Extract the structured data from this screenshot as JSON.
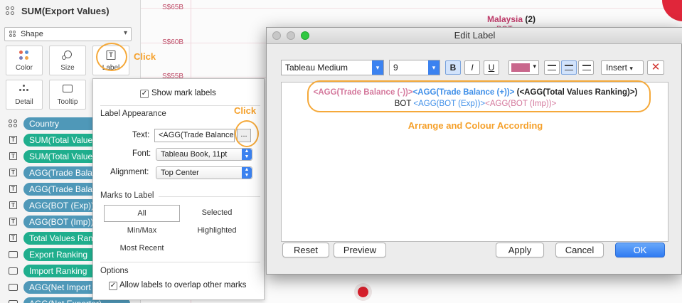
{
  "marks_card": {
    "title": "SUM(Export Values)",
    "mark_type": "Shape",
    "buttons": [
      {
        "label": "Color",
        "icon": "color-dots-icon"
      },
      {
        "label": "Size",
        "icon": "size-icon"
      },
      {
        "label": "Label",
        "icon": "label-icon"
      },
      {
        "label": "Detail",
        "icon": "detail-icon"
      },
      {
        "label": "Tooltip",
        "icon": "tooltip-icon"
      }
    ],
    "fields": [
      {
        "label": "Country",
        "type": "dimension",
        "icon": "detail-dots-icon"
      },
      {
        "label": "SUM(Total Values",
        "type": "measure",
        "icon": "label-icon"
      },
      {
        "label": "SUM(Total Value",
        "type": "measure",
        "icon": "label-icon"
      },
      {
        "label": "AGG(Trade Bala",
        "type": "agg",
        "icon": "label-icon"
      },
      {
        "label": "AGG(Trade Bala",
        "type": "agg",
        "icon": "label-icon"
      },
      {
        "label": "AGG(BOT (Exp))",
        "type": "agg",
        "icon": "label-icon"
      },
      {
        "label": "AGG(BOT (Imp))",
        "type": "agg",
        "icon": "label-icon"
      },
      {
        "label": "Total Values Ran",
        "type": "measure",
        "icon": "label-icon"
      },
      {
        "label": "Export Ranking",
        "type": "measure",
        "icon": "tooltip-icon"
      },
      {
        "label": "Import Ranking",
        "type": "measure",
        "icon": "tooltip-icon"
      },
      {
        "label": "AGG(Net Import",
        "type": "agg",
        "icon": "tooltip-icon"
      },
      {
        "label": "AGG(Net Exporter)",
        "type": "agg",
        "icon": "tooltip-icon"
      }
    ]
  },
  "callouts": {
    "click_1": "Click",
    "click_2": "Click",
    "arrange": "Arrange and Colour According"
  },
  "label_popover": {
    "show_mark_labels": "Show mark labels",
    "show_mark_labels_checked": true,
    "appearance_heading": "Label Appearance",
    "text_label": "Text:",
    "text_value": "<AGG(Trade Balance",
    "ellipsis": "...",
    "font_label": "Font:",
    "font_value": "Tableau Book, 11pt",
    "alignment_label": "Alignment:",
    "alignment_value": "Top Center",
    "marks_heading": "Marks to Label",
    "marks_options": [
      "All",
      "Selected",
      "Min/Max",
      "Highlighted",
      "Most Recent"
    ],
    "marks_selected": "All",
    "options_heading": "Options",
    "allow_overlap": "Allow labels to overlap other marks",
    "allow_overlap_checked": true
  },
  "background_chart": {
    "y_ticks": [
      "S$65B",
      "S$60B",
      "S$55B"
    ],
    "annotation_country": "Malaysia",
    "annotation_rank": "(2)",
    "annotation_partial": "BOT"
  },
  "edit_label": {
    "title": "Edit Label",
    "font_family": "Tableau Medium",
    "font_size": "9",
    "bold": "B",
    "italic": "I",
    "underline": "U",
    "text_color": "#c9678c",
    "insert_label": "Insert",
    "line1": [
      {
        "text": "<AGG(Trade Balance (-))>",
        "color": "#d4789c"
      },
      {
        "text": "<AGG(Trade Balance (+))>",
        "color": "#3f8fe8"
      },
      {
        "text": " (<AGG(Total Values Ranking)>)",
        "color": "#222222"
      }
    ],
    "line2": [
      {
        "text": "BOT ",
        "color": "#222222"
      },
      {
        "text": "<AGG(BOT (Exp))>",
        "color": "#3f8fe8"
      },
      {
        "text": "<AGG(BOT (Imp))>",
        "color": "#d4789c"
      }
    ],
    "buttons": {
      "reset": "Reset",
      "preview": "Preview",
      "apply": "Apply",
      "cancel": "Cancel",
      "ok": "OK"
    }
  }
}
